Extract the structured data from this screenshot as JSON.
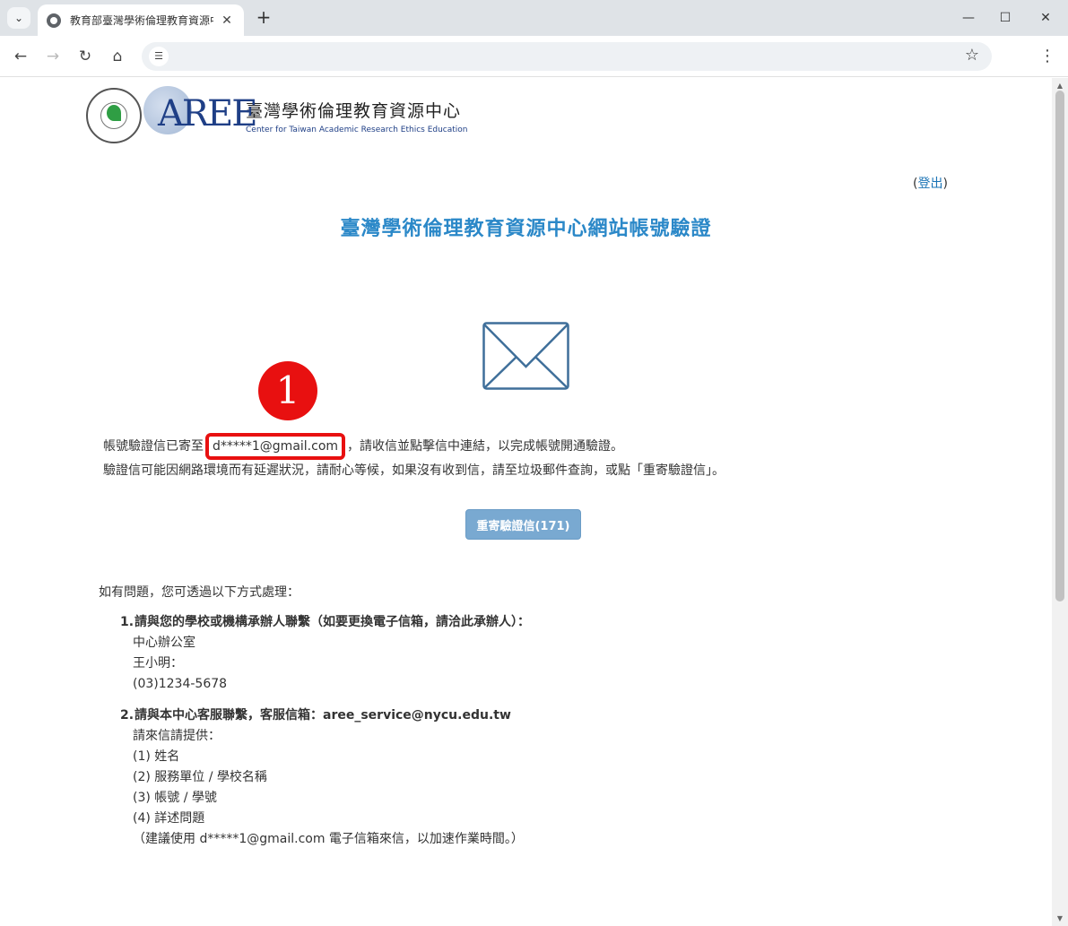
{
  "browser": {
    "tab_title": "教育部臺灣學術倫理教育資源中心",
    "tab_close": "✕",
    "new_tab": "+",
    "url_value": "",
    "window": {
      "minimize": "—",
      "maximize": "☐",
      "close": "✕"
    }
  },
  "header": {
    "org_name_zh": "臺灣學術倫理教育資源中心",
    "org_name_en": "Center for Taiwan Academic Research Ethics Education",
    "logo_text": "AREE",
    "logout_open": "(",
    "logout_label": "登出",
    "logout_close": ")"
  },
  "main": {
    "title": "臺灣學術倫理教育資源中心網站帳號驗證",
    "annotation_number": "1",
    "line1_prefix": "帳號驗證信已寄至",
    "email": "d*****1@gmail.com",
    "line1_suffix": "，請收信並點擊信中連結，以完成帳號開通驗證。",
    "line2": "驗證信可能因網路環境而有延遲狀況，請耐心等候，如果沒有收到信，請至垃圾郵件查詢，或點「重寄驗證信」。",
    "resend_button": "重寄驗證信(171)"
  },
  "help": {
    "intro": "如有問題，您可透過以下方式處理：",
    "item1": {
      "num": "1.",
      "title": "請與您的學校或機構承辦人聯繫（如要更換電子信箱，請洽此承辦人）：",
      "lines": [
        "中心辦公室",
        "王小明：",
        "(03)1234-5678"
      ]
    },
    "item2": {
      "num": "2.",
      "title": "請與本中心客服聯繫，客服信箱：aree_service@nycu.edu.tw",
      "lines": [
        "請來信請提供：",
        "(1) 姓名",
        "(2) 服務單位 / 學校名稱",
        "(3) 帳號 / 學號",
        "(4) 詳述問題",
        "（建議使用 d*****1@gmail.com 電子信箱來信，以加速作業時間。）"
      ]
    }
  },
  "colors": {
    "accent": "#2b88c8",
    "button": "#79a9d1",
    "annotation": "#e81010"
  }
}
